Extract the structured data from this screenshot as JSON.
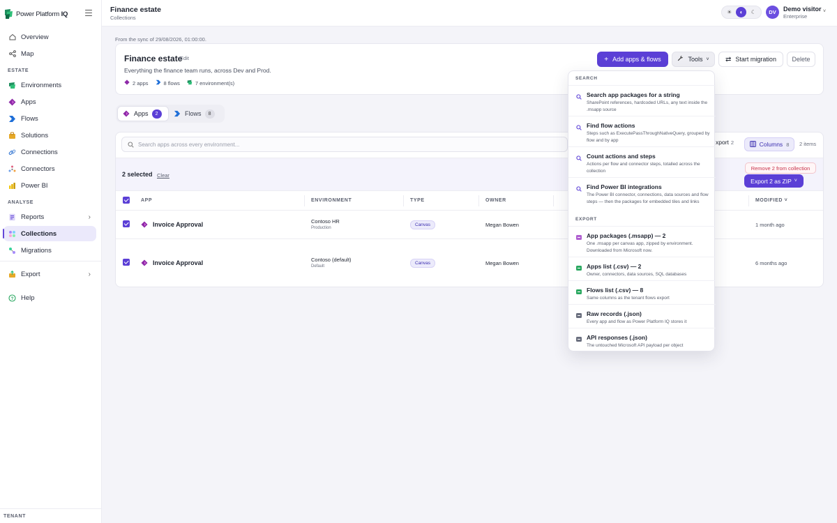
{
  "app": {
    "brand_prefix": "Power Platform ",
    "brand_suffix": "IQ"
  },
  "sidebar": {
    "items_top": [
      {
        "label": "Overview",
        "icon": "home-icon"
      },
      {
        "label": "Map",
        "icon": "share-nodes-icon"
      }
    ],
    "section_estate": "ESTATE",
    "estate_items": [
      {
        "label": "Environments",
        "icon": "environment-icon"
      },
      {
        "label": "Apps",
        "icon": "powerapps-icon"
      },
      {
        "label": "Flows",
        "icon": "powerautomate-icon"
      },
      {
        "label": "Solutions",
        "icon": "solutions-icon"
      },
      {
        "label": "Connections",
        "icon": "link-icon"
      },
      {
        "label": "Connectors",
        "icon": "connector-icon"
      },
      {
        "label": "Power BI",
        "icon": "powerbi-icon"
      }
    ],
    "section_analyse": "ANALYSE",
    "analyse_items": [
      {
        "label": "Reports",
        "icon": "reports-icon"
      },
      {
        "label": "Collections",
        "icon": "collections-icon",
        "active": true
      },
      {
        "label": "Migrations",
        "icon": "migrations-icon"
      }
    ],
    "export_label": "Export",
    "help_label": "Help",
    "section_tenant": "TENANT"
  },
  "header": {
    "title": "Finance estate",
    "subtitle": "Collections",
    "theme_options": [
      "light",
      "system",
      "dark"
    ],
    "theme_selected": "system",
    "user": {
      "initials": "DV",
      "name": "Demo visitor",
      "plan": "Enterprise"
    }
  },
  "sync_note": "From the sync of 29/08/2026, 01:00:00.",
  "collection": {
    "title": "Finance estate",
    "edit_label": "Edit",
    "description": "Everything the finance team runs, across Dev and Prod.",
    "meta": {
      "apps": "2 apps",
      "flows": "8 flows",
      "environments": "7 environment(s)"
    },
    "actions": {
      "add": "Add apps & flows",
      "tools": "Tools",
      "migrate": "Start migration",
      "delete": "Delete"
    }
  },
  "tabs": [
    {
      "label": "Apps",
      "count": "2",
      "active": true
    },
    {
      "label": "Flows",
      "count": "8",
      "active": false
    }
  ],
  "table": {
    "search_placeholder": "Search apps across every environment...",
    "export_label": "xport",
    "export_count": "2",
    "columns_label": "Columns",
    "columns_count": "8",
    "items_count": "2 items",
    "selected_text": "2 selected",
    "clear_label": "Clear",
    "remove_label": "Remove 2 from collection",
    "zip_label": "Export 2 as ZIP",
    "headers": {
      "app": "APP",
      "environment": "ENVIRONMENT",
      "type": "TYPE",
      "owner": "OWNER",
      "modified": "MODIFIED"
    },
    "rows": [
      {
        "name": "Invoice Approval",
        "env": "Contoso HR",
        "env_type": "Production",
        "type": "Canvas",
        "owner": "Megan Bowen",
        "modified": "1 month ago",
        "selected": true
      },
      {
        "name": "Invoice Approval",
        "env": "Contoso (default)",
        "env_type": "Default",
        "type": "Canvas",
        "owner": "Megan Bowen",
        "modified": "6 months ago",
        "selected": true
      }
    ]
  },
  "tools_menu": {
    "search_section": "SEARCH",
    "search_items": [
      {
        "title": "Search app packages for a string",
        "desc": "SharePoint references, hardcoded URLs, any text inside the .msapp source",
        "icon": "search-icon"
      },
      {
        "title": "Find flow actions",
        "desc": "Steps such as ExecutePassThroughNativeQuery, grouped by flow and by app",
        "icon": "search-icon"
      },
      {
        "title": "Count actions and steps",
        "desc": "Actions per flow and connector steps, totalled across the collection",
        "icon": "search-icon"
      },
      {
        "title": "Find Power BI integrations",
        "desc": "The Power BI connector, connections, data sources and flow steps — then the packages for embedded tiles and links",
        "icon": "search-icon"
      }
    ],
    "export_section": "EXPORT",
    "export_items": [
      {
        "title": "App packages (.msapp) — 2",
        "desc": "One .msapp per canvas app, zipped by environment. Downloaded from Microsoft now.",
        "icon": "msapp-file-icon",
        "color": "#b05fd0"
      },
      {
        "title": "Apps list (.csv) — 2",
        "desc": "Owner, connectors, data sources, SQL databases",
        "icon": "csv-file-icon",
        "color": "#2aa860"
      },
      {
        "title": "Flows list (.csv) — 8",
        "desc": "Same columns as the tenant flows export",
        "icon": "csv-file-icon",
        "color": "#2aa860"
      },
      {
        "title": "Raw records (.json)",
        "desc": "Every app and flow as Power Platform IQ stores it",
        "icon": "json-file-icon",
        "color": "#6a6f7e"
      },
      {
        "title": "API responses (.json)",
        "desc": "The untouched Microsoft API payload per object",
        "icon": "json-file-icon",
        "color": "#6a6f7e"
      }
    ]
  },
  "colors": {
    "accent": "#5b3fd6",
    "danger": "#c8324a"
  }
}
